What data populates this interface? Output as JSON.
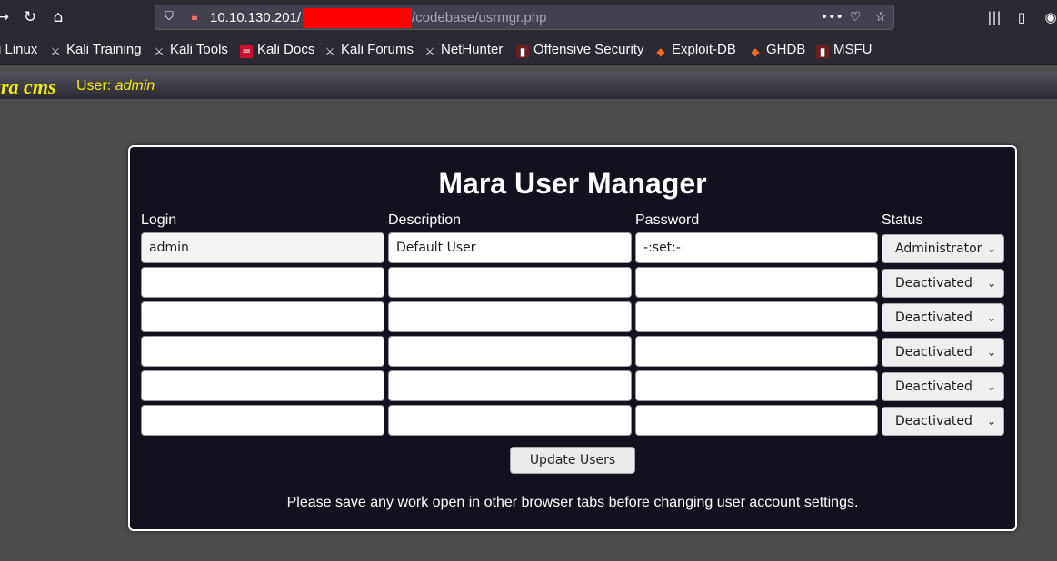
{
  "browser": {
    "url_host": "10.10.130.201/",
    "url_path": "/codebase/usrmgr.php",
    "bookmarks": [
      {
        "label": "i Linux",
        "icon": "kali-icon"
      },
      {
        "label": "Kali Training",
        "icon": "kali-icon"
      },
      {
        "label": "Kali Tools",
        "icon": "kali-icon"
      },
      {
        "label": "Kali Docs",
        "icon": "docs-icon"
      },
      {
        "label": "Kali Forums",
        "icon": "kali-icon"
      },
      {
        "label": "NetHunter",
        "icon": "kali-icon"
      },
      {
        "label": "Offensive Security",
        "icon": "offsec-icon"
      },
      {
        "label": "Exploit-DB",
        "icon": "exploitdb-icon"
      },
      {
        "label": "GHDB",
        "icon": "exploitdb-icon"
      },
      {
        "label": "MSFU",
        "icon": "offsec-icon"
      }
    ]
  },
  "header": {
    "logo": "ara cms",
    "user_label": "User:",
    "user_name": "admin"
  },
  "manager": {
    "title": "Mara User Manager",
    "columns": {
      "login": "Login",
      "description": "Description",
      "password": "Password",
      "status": "Status"
    },
    "rows": [
      {
        "login": "admin",
        "description": "Default User",
        "password": "-:set:-",
        "status": "Administrator"
      },
      {
        "login": "",
        "description": "",
        "password": "",
        "status": "Deactivated"
      },
      {
        "login": "",
        "description": "",
        "password": "",
        "status": "Deactivated"
      },
      {
        "login": "",
        "description": "",
        "password": "",
        "status": "Deactivated"
      },
      {
        "login": "",
        "description": "",
        "password": "",
        "status": "Deactivated"
      },
      {
        "login": "",
        "description": "",
        "password": "",
        "status": "Deactivated"
      }
    ],
    "update_button": "Update Users",
    "notice": "Please save any work open in other browser tabs before changing user account settings."
  },
  "colors": {
    "chrome_bg": "#2b2a33",
    "page_bg": "#4c4c4c",
    "panel_bg": "#12121e",
    "header_text": "#f0f000",
    "redaction": "#ff0000"
  }
}
